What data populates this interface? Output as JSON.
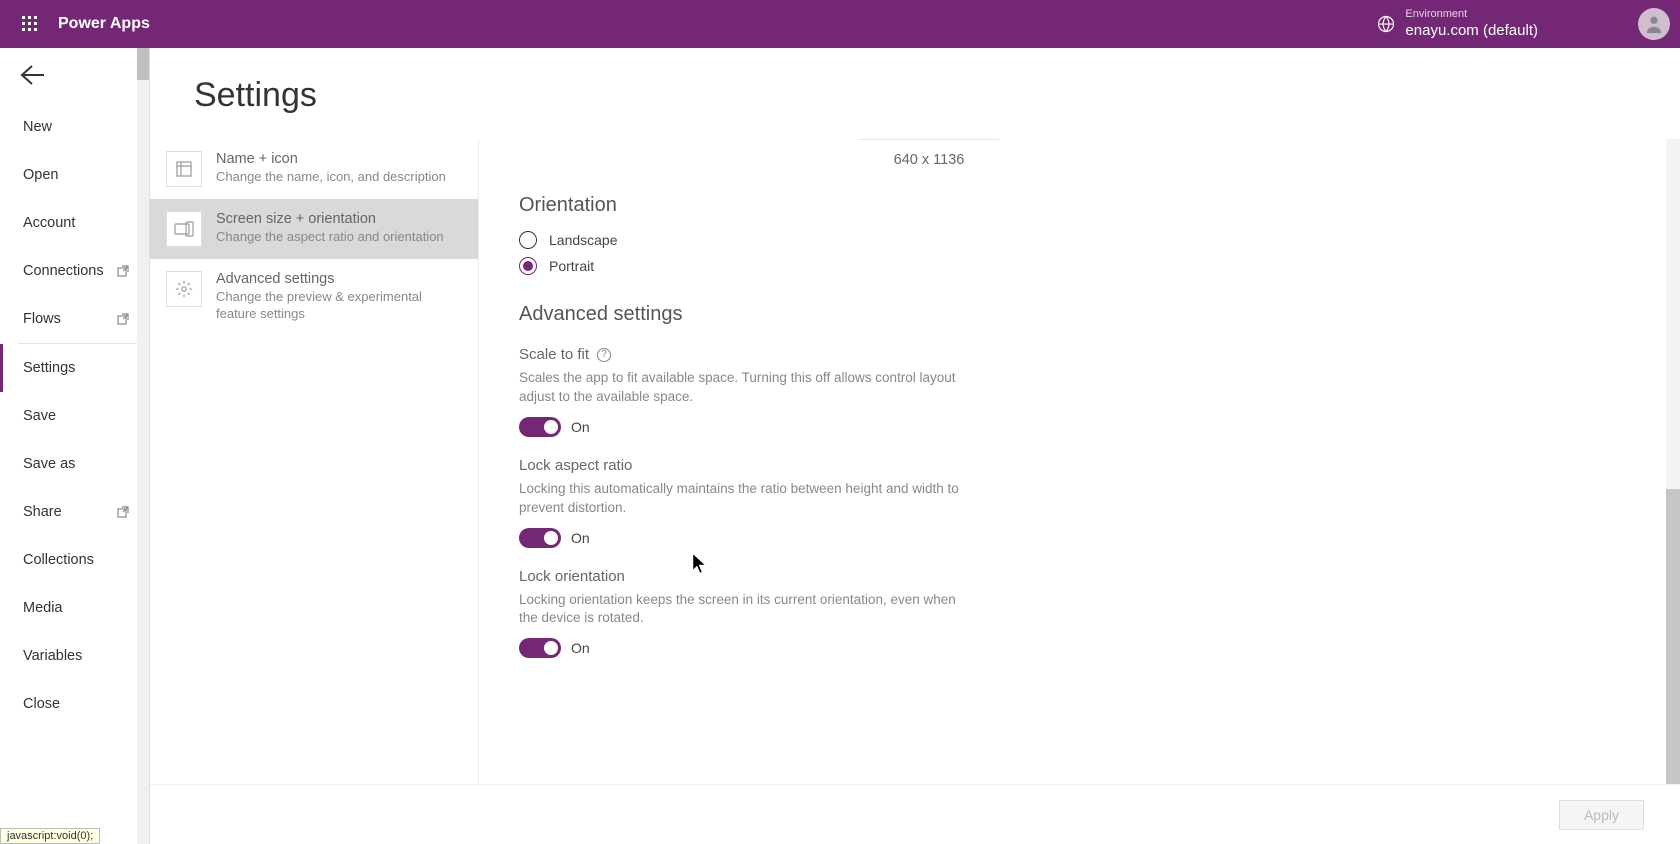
{
  "header": {
    "app_title": "Power Apps",
    "environment_label": "Environment",
    "environment_value": "enayu.com (default)"
  },
  "sidebar": {
    "items": [
      {
        "label": "New"
      },
      {
        "label": "Open"
      },
      {
        "label": "Account"
      },
      {
        "label": "Connections",
        "popout": true
      },
      {
        "label": "Flows",
        "popout": true
      },
      {
        "label": "Settings",
        "active": true
      },
      {
        "label": "Save"
      },
      {
        "label": "Save as"
      },
      {
        "label": "Share",
        "popout": true
      },
      {
        "label": "Collections"
      },
      {
        "label": "Media"
      },
      {
        "label": "Variables"
      },
      {
        "label": "Close"
      }
    ]
  },
  "page": {
    "title": "Settings"
  },
  "tabs": [
    {
      "title": "Name + icon",
      "desc": "Change the name, icon, and description"
    },
    {
      "title": "Screen size + orientation",
      "desc": "Change the aspect ratio and orientation",
      "selected": true
    },
    {
      "title": "Advanced settings",
      "desc": "Change the preview & experimental feature settings"
    }
  ],
  "detail": {
    "dimensions": "640 x 1136",
    "orientation_heading": "Orientation",
    "orientation_options": {
      "landscape": "Landscape",
      "portrait": "Portrait"
    },
    "orientation_selected": "portrait",
    "advanced_heading": "Advanced settings",
    "settings": [
      {
        "title": "Scale to fit",
        "help": true,
        "desc": "Scales the app to fit available space. Turning this off allows control layout adjust to the available space.",
        "state": "On"
      },
      {
        "title": "Lock aspect ratio",
        "help": false,
        "desc": "Locking this automatically maintains the ratio between height and width to prevent distortion.",
        "state": "On"
      },
      {
        "title": "Lock orientation",
        "help": false,
        "desc": "Locking orientation keeps the screen in its current orientation, even when the device is rotated.",
        "state": "On"
      }
    ]
  },
  "footer": {
    "apply_label": "Apply"
  },
  "status": "javascript:void(0);"
}
